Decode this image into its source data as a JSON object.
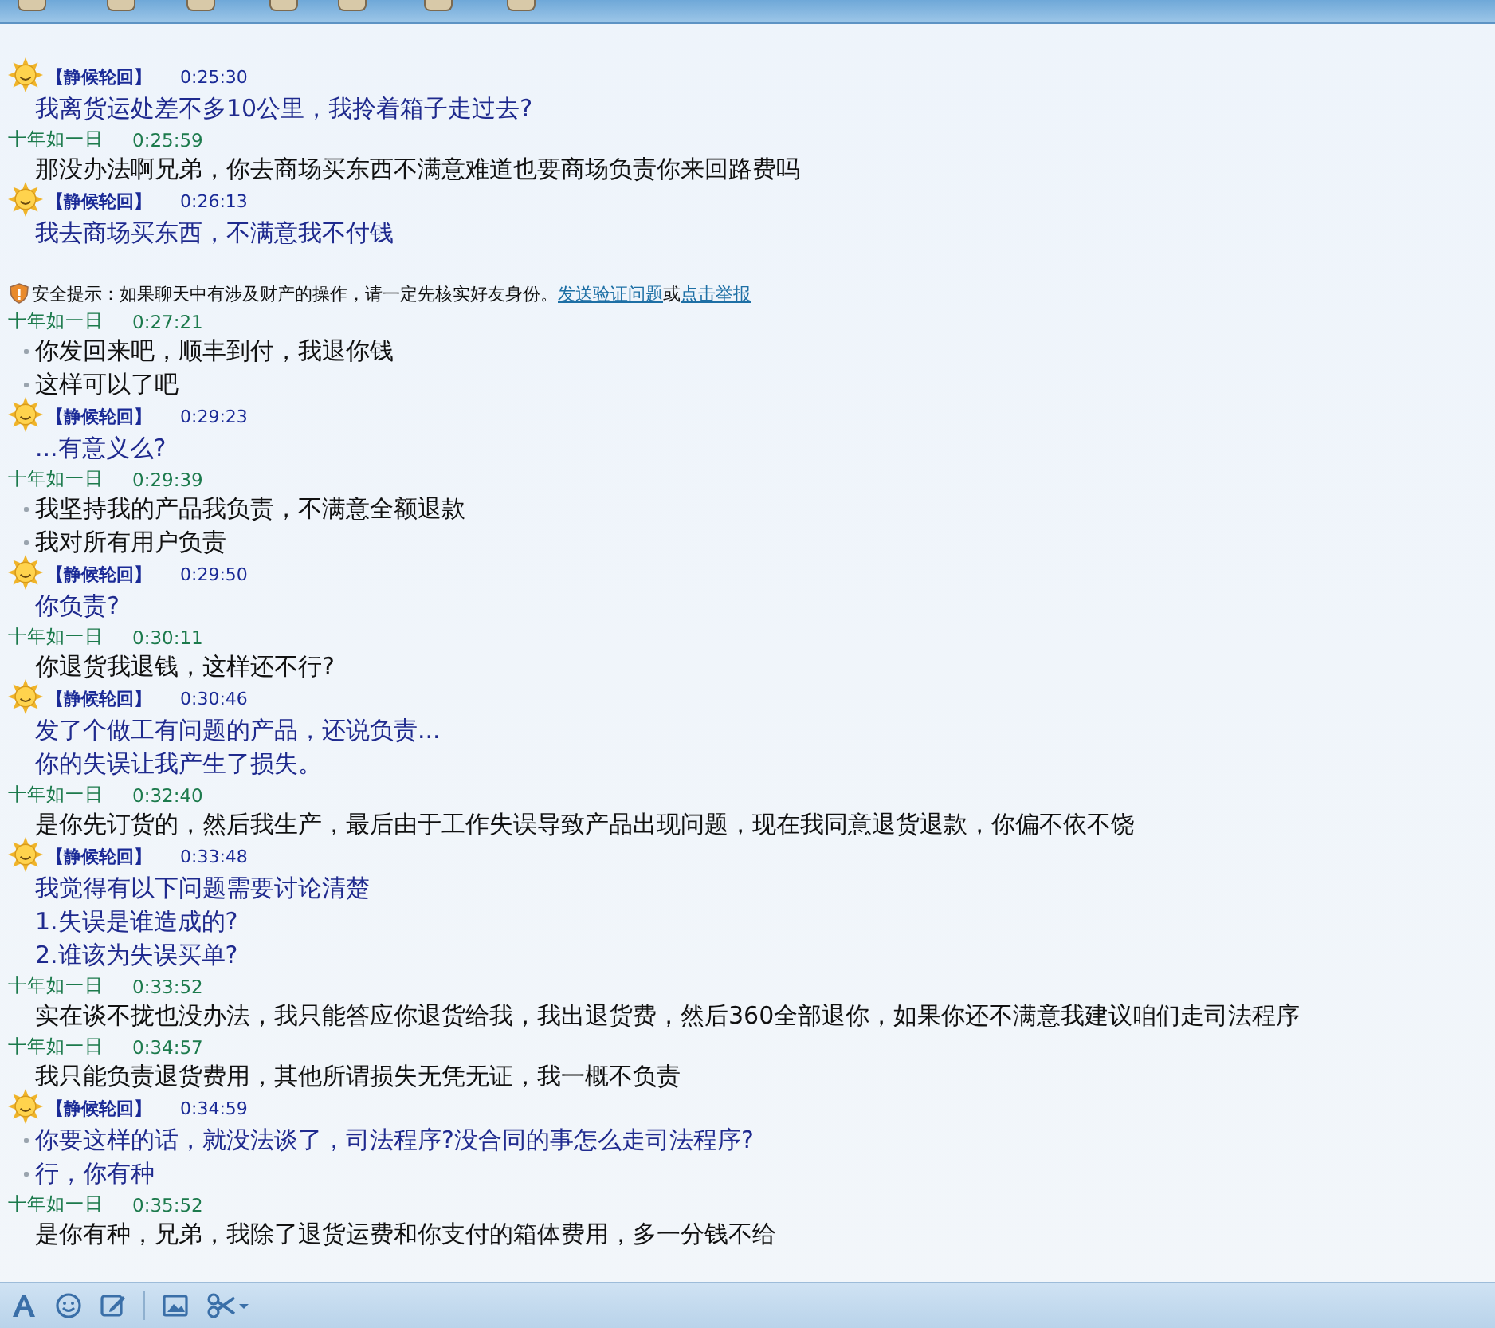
{
  "messages": [
    {
      "kind": "other",
      "sender": "【静候轮回】",
      "time": "0:25:30",
      "lines": [
        {
          "text": "我离货运处差不多10公里，我拎着箱子走过去?",
          "bullet": false
        }
      ]
    },
    {
      "kind": "self",
      "sender": "十年如一日",
      "time": "0:25:59",
      "lines": [
        {
          "text": "那没办法啊兄弟，你去商场买东西不满意难道也要商场负责你来回路费吗",
          "bullet": false
        }
      ]
    },
    {
      "kind": "other",
      "sender": "【静候轮回】",
      "time": "0:26:13",
      "lines": [
        {
          "text": "我去商场买东西，不满意我不付钱",
          "bullet": false
        }
      ]
    },
    {
      "kind": "notice",
      "text": "安全提示：如果聊天中有涉及财产的操作，请一定先核实好友身份。",
      "links": [
        "发送验证问题",
        "点击举报"
      ],
      "joiner": "或"
    },
    {
      "kind": "self",
      "sender": "十年如一日",
      "time": "0:27:21",
      "lines": [
        {
          "text": "你发回来吧，顺丰到付，我退你钱",
          "bullet": true
        },
        {
          "text": "这样可以了吧",
          "bullet": true
        }
      ]
    },
    {
      "kind": "other",
      "sender": "【静候轮回】",
      "time": "0:29:23",
      "lines": [
        {
          "text": "...有意义么?",
          "bullet": false
        }
      ]
    },
    {
      "kind": "self",
      "sender": "十年如一日",
      "time": "0:29:39",
      "lines": [
        {
          "text": "我坚持我的产品我负责，不满意全额退款",
          "bullet": true
        },
        {
          "text": "我对所有用户负责",
          "bullet": true
        }
      ]
    },
    {
      "kind": "other",
      "sender": "【静候轮回】",
      "time": "0:29:50",
      "lines": [
        {
          "text": "你负责?",
          "bullet": false
        }
      ]
    },
    {
      "kind": "self",
      "sender": "十年如一日",
      "time": "0:30:11",
      "lines": [
        {
          "text": "你退货我退钱，这样还不行?",
          "bullet": false
        }
      ]
    },
    {
      "kind": "other",
      "sender": "【静候轮回】",
      "time": "0:30:46",
      "lines": [
        {
          "text": "发了个做工有问题的产品，还说负责...",
          "bullet": false
        },
        {
          "text": "你的失误让我产生了损失。",
          "bullet": false
        }
      ]
    },
    {
      "kind": "self",
      "sender": "十年如一日",
      "time": "0:32:40",
      "lines": [
        {
          "text": "是你先订货的，然后我生产，最后由于工作失误导致产品出现问题，现在我同意退货退款，你偏不依不饶",
          "bullet": false
        }
      ]
    },
    {
      "kind": "other",
      "sender": "【静候轮回】",
      "time": "0:33:48",
      "lines": [
        {
          "text": "我觉得有以下问题需要讨论清楚",
          "bullet": false
        },
        {
          "text": "1.失误是谁造成的?",
          "bullet": false
        },
        {
          "text": "2.谁该为失误买单?",
          "bullet": false
        }
      ]
    },
    {
      "kind": "self",
      "sender": "十年如一日",
      "time": "0:33:52",
      "lines": [
        {
          "text": "实在谈不拢也没办法，我只能答应你退货给我，我出退货费，然后360全部退你，如果你还不满意我建议咱们走司法程序",
          "bullet": false
        }
      ]
    },
    {
      "kind": "self",
      "sender": "十年如一日",
      "time": "0:34:57",
      "lines": [
        {
          "text": "我只能负责退货费用，其他所谓损失无凭无证，我一概不负责",
          "bullet": false
        }
      ]
    },
    {
      "kind": "other",
      "sender": "【静候轮回】",
      "time": "0:34:59",
      "lines": [
        {
          "text": "你要这样的话，就没法谈了，司法程序?没合同的事怎么走司法程序?",
          "bullet": true
        },
        {
          "text": "行，你有种",
          "bullet": true
        }
      ]
    },
    {
      "kind": "self",
      "sender": "十年如一日",
      "time": "0:35:52",
      "lines": [
        {
          "text": "是你有种，兄弟，我除了退货运费和你支付的箱体费用，多一分钱不给",
          "bullet": false
        }
      ]
    }
  ]
}
